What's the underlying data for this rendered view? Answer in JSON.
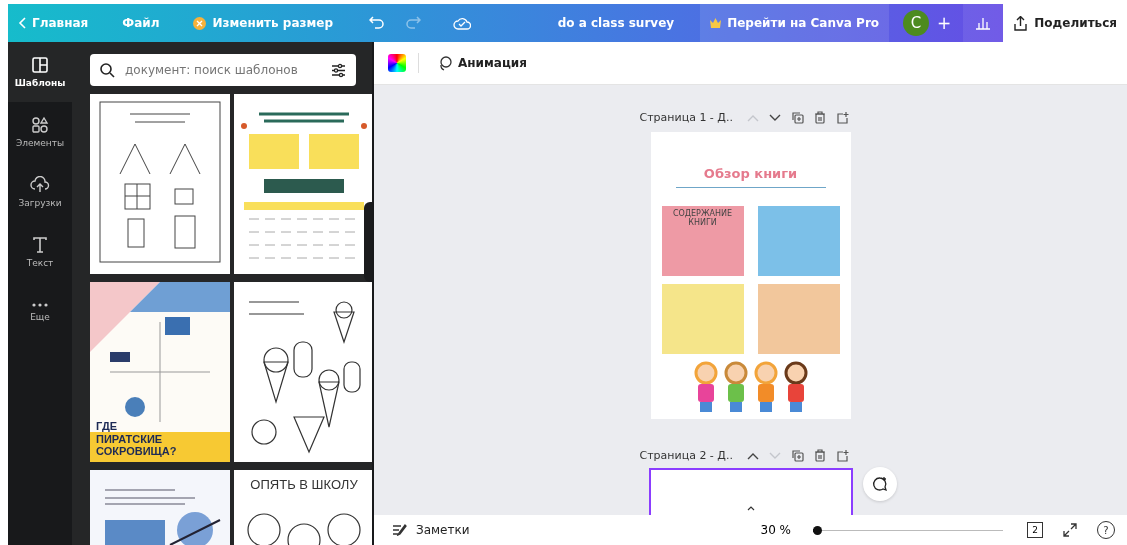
{
  "topbar": {
    "back": "Главная",
    "file": "Файл",
    "resize": "Изменить размер",
    "title": "do a class survey",
    "pro": "Перейти на Canva Pro",
    "avatar": "C",
    "add": "+",
    "share": "Поделиться"
  },
  "rail": [
    {
      "label": "Шаблоны",
      "kind": "templates",
      "selected": true
    },
    {
      "label": "Элементы",
      "kind": "elements",
      "selected": false
    },
    {
      "label": "Загрузки",
      "kind": "uploads",
      "selected": false
    },
    {
      "label": "Текст",
      "kind": "text",
      "selected": false
    },
    {
      "label": "Еще",
      "kind": "more",
      "selected": false
    }
  ],
  "search": {
    "placeholder": "документ: поиск шаблонов"
  },
  "templates": [
    {
      "kind": "worksheet"
    },
    {
      "kind": "group-task"
    },
    {
      "kind": "pirate",
      "title": "ГДЕ ПИРАТСКИЕ СОКРОВИЩА?"
    },
    {
      "kind": "ice-cream"
    },
    {
      "kind": "space"
    },
    {
      "kind": "school",
      "title": "ОПЯТЬ В ШКОЛУ"
    }
  ],
  "toolbar": {
    "animation": "Анимация"
  },
  "pages": [
    {
      "label": "Страница 1 - Д..",
      "selected": false,
      "up_disabled": true,
      "down_disabled": false,
      "document": {
        "title": "Обзор книги",
        "boxes": [
          {
            "color": "#ee9aa5",
            "text": "СОДЕРЖАНИЕ КНИГИ"
          },
          {
            "color": "#7cc0e8"
          },
          {
            "color": "#f5e58a"
          },
          {
            "color": "#f2c79c"
          }
        ]
      }
    },
    {
      "label": "Страница 2 - Д..",
      "selected": true,
      "up_disabled": false,
      "down_disabled": true
    }
  ],
  "bottombar": {
    "notes": "Заметки",
    "zoom": "30 %",
    "zoom_slider": {
      "level": 0.02
    },
    "page_count": "2",
    "help": "?"
  }
}
